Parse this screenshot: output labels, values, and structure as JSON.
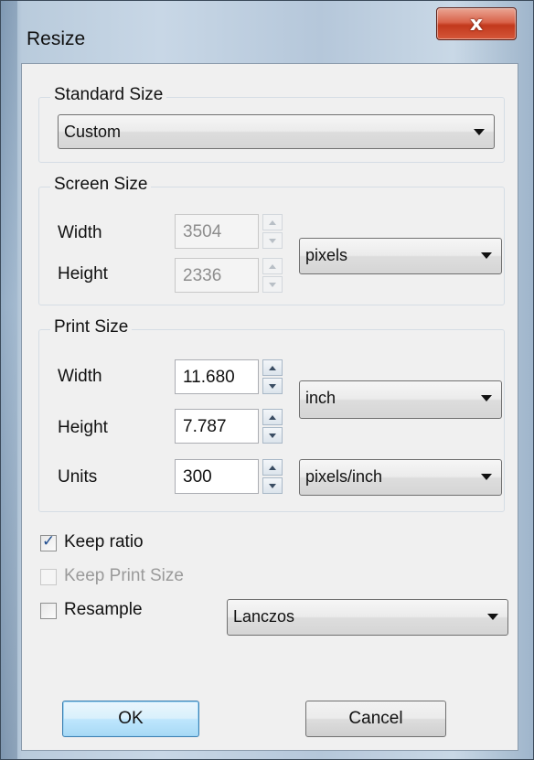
{
  "window": {
    "title": "Resize",
    "close_glyph": "x"
  },
  "standard_size": {
    "title": "Standard Size",
    "selected": "Custom"
  },
  "screen_size": {
    "title": "Screen Size",
    "width_label": "Width",
    "width_value": "3504",
    "height_label": "Height",
    "height_value": "2336",
    "unit_selected": "pixels"
  },
  "print_size": {
    "title": "Print Size",
    "width_label": "Width",
    "width_value": "11.680",
    "height_label": "Height",
    "height_value": "7.787",
    "units_label": "Units",
    "units_value": "300",
    "unit_selected": "inch",
    "resolution_unit_selected": "pixels/inch"
  },
  "options": {
    "keep_ratio": {
      "label": "Keep ratio",
      "checked": true,
      "enabled": true
    },
    "keep_print_size": {
      "label": "Keep Print Size",
      "checked": false,
      "enabled": false
    },
    "resample": {
      "label": "Resample",
      "checked": false,
      "enabled": true
    },
    "resample_method_selected": "Lanczos"
  },
  "buttons": {
    "ok": "OK",
    "cancel": "Cancel"
  },
  "icons": {
    "close": "close-icon",
    "dropdown": "chevron-down-icon",
    "spin_up": "arrow-up-icon",
    "spin_down": "arrow-down-icon",
    "check": "checkmark-icon"
  },
  "colors": {
    "close_button": "#c8402a",
    "default_button_border": "#3c7fb1",
    "check_color": "#1f4d8f"
  }
}
